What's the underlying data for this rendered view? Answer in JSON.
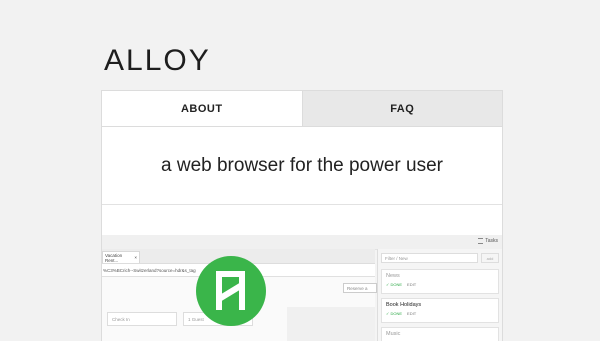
{
  "brand": {
    "title": "ALLOY"
  },
  "tabs": [
    {
      "label": "ABOUT",
      "active": true
    },
    {
      "label": "FAQ",
      "active": false
    }
  ],
  "tagline": "a web browser for the power user",
  "preview": {
    "tasks_label": "Tasks",
    "browser_tab_title": "Vacation Rent...",
    "browser_tab_close": "×",
    "url": "%C3%BCrich--Switzerland?source=hdr&s_tag",
    "reserve_label": "Reserve a",
    "check_in_placeholder": "Check In",
    "guest_placeholder": "1 Guest",
    "filter_placeholder": "Filter / New",
    "add_label": "add",
    "tasks": [
      {
        "title": "News",
        "done_label": "✓ DONE",
        "edit_label": "EDIT",
        "muted": true
      },
      {
        "title": "Book Holidays",
        "done_label": "✓ DONE",
        "edit_label": "EDIT",
        "muted": false
      },
      {
        "title": "Music",
        "done_label": "",
        "edit_label": "",
        "muted": true
      }
    ]
  },
  "colors": {
    "accent": "#3ab54a",
    "done": "#2eaa48"
  },
  "icons": {
    "app_logo": "alloy-logo-icon",
    "tasks": "list-icon"
  }
}
